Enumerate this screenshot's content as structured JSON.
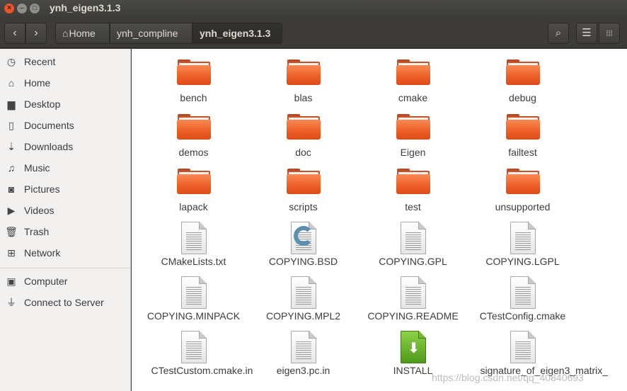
{
  "window": {
    "title": "ynh_eigen3.1.3",
    "close_glyph": "×",
    "min_glyph": "–",
    "max_glyph": "□"
  },
  "toolbar": {
    "back_glyph": "‹",
    "forward_glyph": "›",
    "home_glyph": "⌂",
    "breadcrumbs": [
      "Home",
      "ynh_compline",
      "ynh_eigen3.1.3"
    ],
    "search_glyph": "⌕",
    "list_glyph": "☰",
    "grid_glyph": "⁞⁞⁞"
  },
  "sidebar": {
    "items": [
      {
        "label": "Recent",
        "icon": "clock-icon",
        "glyph": "◷"
      },
      {
        "label": "Home",
        "icon": "home-icon",
        "glyph": "⌂"
      },
      {
        "label": "Desktop",
        "icon": "folder-icon",
        "glyph": "▆"
      },
      {
        "label": "Documents",
        "icon": "document-icon",
        "glyph": "▯"
      },
      {
        "label": "Downloads",
        "icon": "download-icon",
        "glyph": "⇣"
      },
      {
        "label": "Music",
        "icon": "music-icon",
        "glyph": "♫"
      },
      {
        "label": "Pictures",
        "icon": "camera-icon",
        "glyph": "◙"
      },
      {
        "label": "Videos",
        "icon": "video-icon",
        "glyph": "▶"
      },
      {
        "label": "Trash",
        "icon": "trash-icon",
        "glyph": "🗑"
      },
      {
        "label": "Network",
        "icon": "network-icon",
        "glyph": "⊞"
      }
    ],
    "devices": [
      {
        "label": "Computer",
        "icon": "computer-icon",
        "glyph": "▣"
      },
      {
        "label": "Connect to Server",
        "icon": "server-icon",
        "glyph": "⏚"
      }
    ]
  },
  "files": [
    {
      "name": "bench",
      "type": "folder"
    },
    {
      "name": "blas",
      "type": "folder"
    },
    {
      "name": "cmake",
      "type": "folder"
    },
    {
      "name": "debug",
      "type": "folder"
    },
    {
      "name": "demos",
      "type": "folder"
    },
    {
      "name": "doc",
      "type": "folder"
    },
    {
      "name": "Eigen",
      "type": "folder"
    },
    {
      "name": "failtest",
      "type": "folder"
    },
    {
      "name": "lapack",
      "type": "folder"
    },
    {
      "name": "scripts",
      "type": "folder"
    },
    {
      "name": "test",
      "type": "folder"
    },
    {
      "name": "unsupported",
      "type": "folder"
    },
    {
      "name": "CMakeLists.txt",
      "type": "text"
    },
    {
      "name": "COPYING.BSD",
      "type": "copying"
    },
    {
      "name": "COPYING.GPL",
      "type": "text"
    },
    {
      "name": "COPYING.LGPL",
      "type": "text"
    },
    {
      "name": "COPYING.MINPACK",
      "type": "text"
    },
    {
      "name": "COPYING.MPL2",
      "type": "text"
    },
    {
      "name": "COPYING.README",
      "type": "text"
    },
    {
      "name": "CTestConfig.cmake",
      "type": "text"
    },
    {
      "name": "CTestCustom.cmake.in",
      "type": "text"
    },
    {
      "name": "eigen3.pc.in",
      "type": "text"
    },
    {
      "name": "INSTALL",
      "type": "install"
    },
    {
      "name": "signature_of_eigen3_matrix_",
      "type": "text"
    }
  ],
  "watermark": "https://blog.csdn.net/qq_40840693",
  "colors": {
    "folder": "#ec5c25",
    "titlebar": "#3c3b37",
    "sidebar": "#f2f1f0",
    "close": "#e9542a",
    "install": "#4e9a1a"
  }
}
